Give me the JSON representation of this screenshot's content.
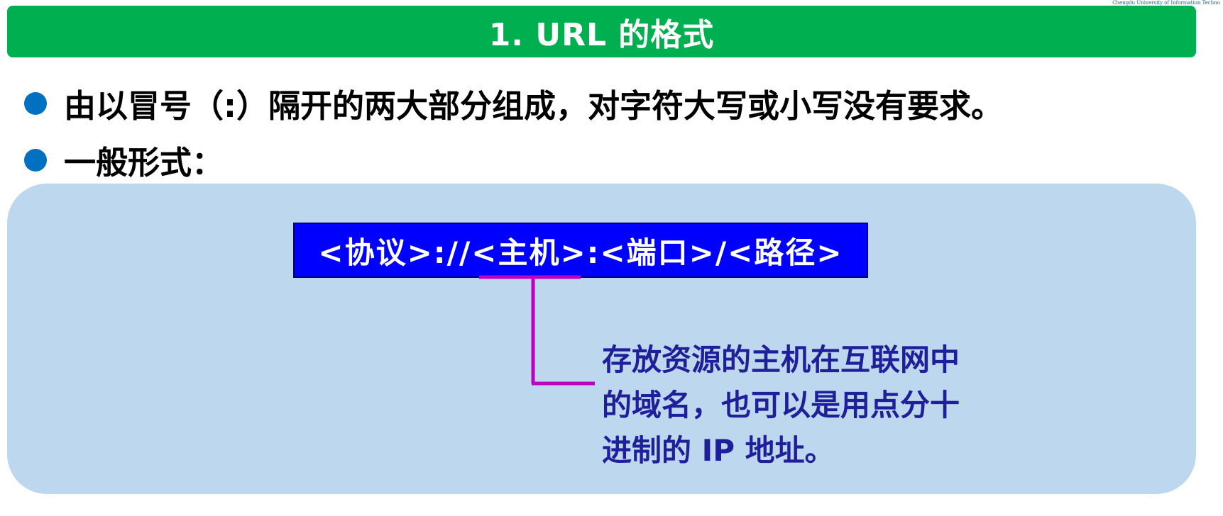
{
  "header": {
    "title": "1. URL 的格式",
    "watermark": "Chengdu University of Information Techno"
  },
  "bullets": [
    {
      "text": "由以冒号（:）隔开的两大部分组成，对字符大写或小写没有要求。"
    },
    {
      "text": "一般形式："
    }
  ],
  "diagram": {
    "formula": "<协议>://<主机>:<端口>/<路径>",
    "note": "存放资源的主机在互联网中\n的域名，也可以是用点分十\n进制的 IP 地址。"
  },
  "colors": {
    "title_bar": "#00b050",
    "bullet": "#0070c0",
    "panel": "#bdd7ee",
    "formula_bg": "#0000ff",
    "connector": "#c000c0",
    "note_text": "#1f1f99"
  }
}
